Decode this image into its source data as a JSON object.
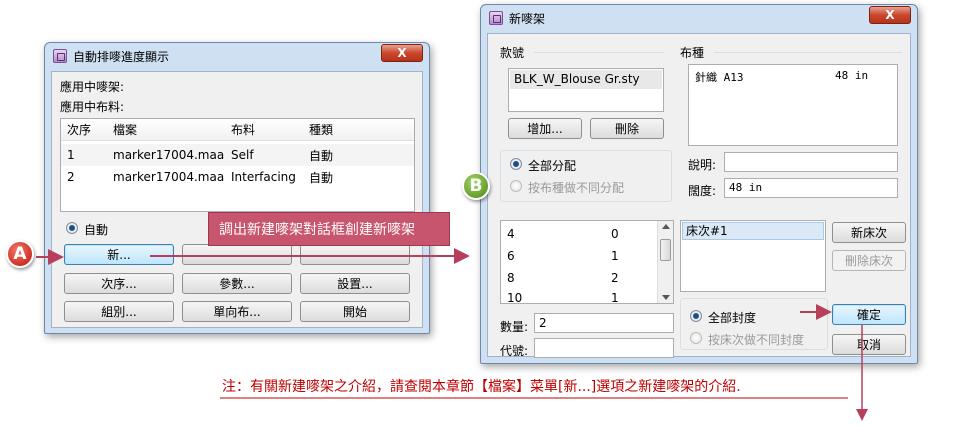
{
  "left_window": {
    "title": "自動排嘜進度顯示",
    "close_label": "X",
    "active_marker_label": "應用中嘜架:",
    "active_fabric_label": "應用中布料:",
    "table": {
      "headers": [
        "次序",
        "檔案",
        "布料",
        "種類"
      ],
      "rows": [
        [
          "1",
          "marker17004.maa",
          "Self",
          "自動"
        ],
        [
          "2",
          "marker17004.maa",
          "Interfacing",
          "自動"
        ]
      ]
    },
    "auto_radio_label": "自動",
    "buttons": {
      "new": "新...",
      "order": "次序...",
      "params": "參數...",
      "settings": "設置...",
      "group": "組別...",
      "one_way": "單向布...",
      "start": "開始"
    }
  },
  "right_window": {
    "title": "新嘜架",
    "close_label": "X",
    "style_group_label": "款號",
    "style_item": "BLK_W_Blouse Gr.sty",
    "add_button": "增加...",
    "delete_button": "刪除",
    "fabric_group_label": "布種",
    "fabric_item": {
      "name": "針織 A13",
      "width": "48 in"
    },
    "description_label": "說明:",
    "description_value": "",
    "width_label": "闊度:",
    "width_value": "48 in",
    "distribution": {
      "all_label": "全部分配",
      "by_fabric_label": "按布種做不同分配"
    },
    "size_list": [
      [
        "4",
        "0"
      ],
      [
        "6",
        "1"
      ],
      [
        "8",
        "2"
      ],
      [
        "10",
        "1"
      ]
    ],
    "quantity_label": "數量:",
    "quantity_value": "2",
    "code_label": "代號:",
    "code_value": "",
    "bed_list": [
      "床次#1"
    ],
    "new_bed_button": "新床次",
    "delete_bed_button": "刪除床次",
    "seal": {
      "all_label": "全部封度",
      "by_bed_label": "按床次做不同封度"
    },
    "ok_button": "確定",
    "cancel_button": "取消"
  },
  "annotations": {
    "marker_a": "A",
    "marker_b": "B",
    "callout_text": "調出新建嘜架對話框創建新嘜架",
    "note_text": "注：有關新建嘜架之介紹，請查閱本章節【檔案】菜單[新...]選項之新建嘜架的介紹."
  },
  "colors": {
    "callout_bg": "#c8556e",
    "arrow": "#b6405b",
    "marker_a": "#d63a2e",
    "marker_b": "#6ea534",
    "note_text": "#c00000"
  }
}
